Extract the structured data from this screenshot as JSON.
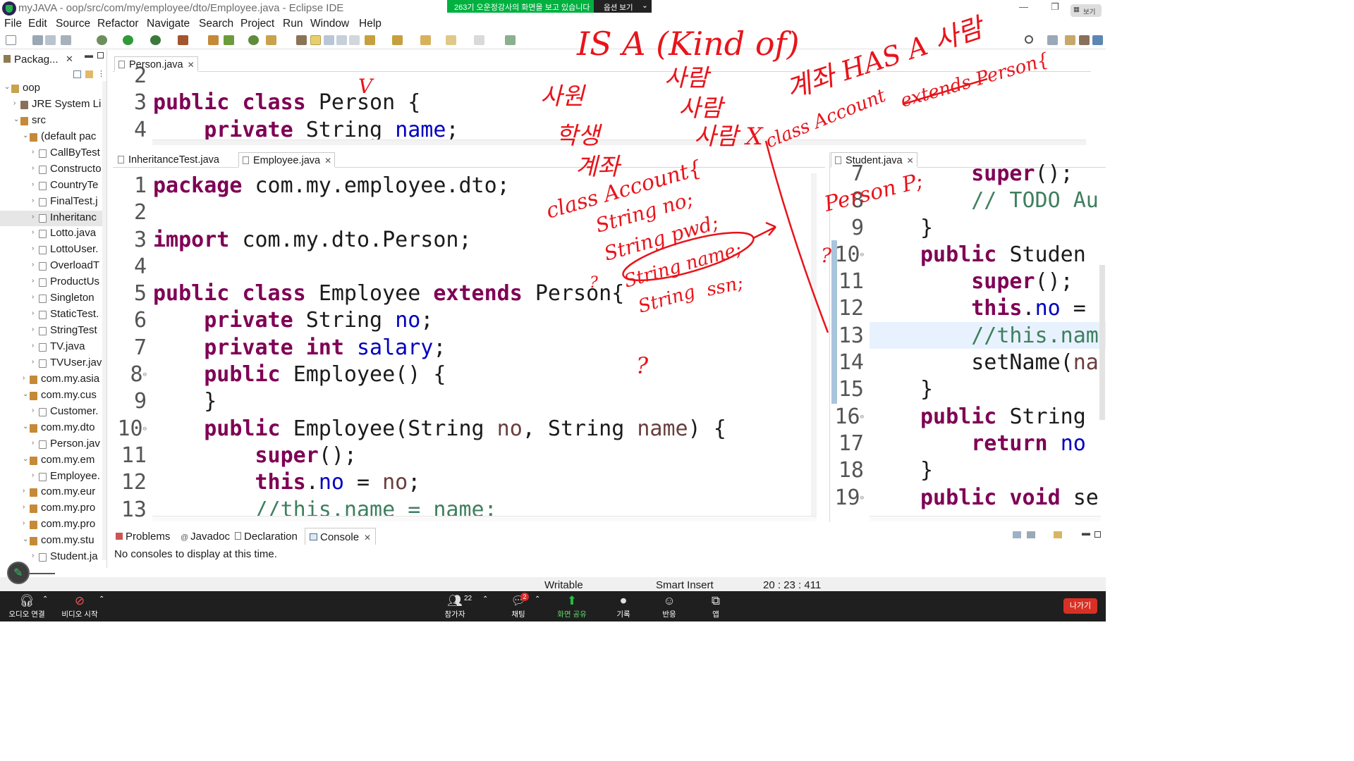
{
  "window": {
    "title": "myJAVA - oop/src/com/my/employee/dto/Employee.java - Eclipse IDE"
  },
  "share_banner": {
    "text": "263기 오운정강사의 화면을 보고 있습니다",
    "options": "옵션 보기",
    "collapse": "보기"
  },
  "menu": [
    "File",
    "Edit",
    "Source",
    "Refactor",
    "Navigate",
    "Search",
    "Project",
    "Run",
    "Window",
    "Help"
  ],
  "package_explorer": {
    "title": "Packag...",
    "items": [
      {
        "label": "oop",
        "indent": 0,
        "expanded": true,
        "icon": "project"
      },
      {
        "label": "JRE System Li",
        "indent": 1,
        "expanded": false,
        "icon": "library"
      },
      {
        "label": "src",
        "indent": 1,
        "expanded": true,
        "icon": "folder"
      },
      {
        "label": "(default pac",
        "indent": 2,
        "expanded": true,
        "icon": "package"
      },
      {
        "label": "CallByTest",
        "indent": 3,
        "expanded": false,
        "icon": "java"
      },
      {
        "label": "Constructo",
        "indent": 3,
        "expanded": false,
        "icon": "java"
      },
      {
        "label": "CountryTe",
        "indent": 3,
        "expanded": false,
        "icon": "java"
      },
      {
        "label": "FinalTest.j",
        "indent": 3,
        "expanded": false,
        "icon": "java"
      },
      {
        "label": "Inheritanc",
        "indent": 3,
        "expanded": false,
        "icon": "java",
        "selected": true
      },
      {
        "label": "Lotto.java",
        "indent": 3,
        "expanded": false,
        "icon": "java"
      },
      {
        "label": "LottoUser.",
        "indent": 3,
        "expanded": false,
        "icon": "java"
      },
      {
        "label": "OverloadT",
        "indent": 3,
        "expanded": false,
        "icon": "java"
      },
      {
        "label": "ProductUs",
        "indent": 3,
        "expanded": false,
        "icon": "java"
      },
      {
        "label": "Singleton",
        "indent": 3,
        "expanded": false,
        "icon": "java"
      },
      {
        "label": "StaticTest.",
        "indent": 3,
        "expanded": false,
        "icon": "java"
      },
      {
        "label": "StringTest",
        "indent": 3,
        "expanded": false,
        "icon": "java"
      },
      {
        "label": "TV.java",
        "indent": 3,
        "expanded": false,
        "icon": "java"
      },
      {
        "label": "TVUser.jav",
        "indent": 3,
        "expanded": false,
        "icon": "java"
      },
      {
        "label": "com.my.asia",
        "indent": 2,
        "expanded": false,
        "icon": "package"
      },
      {
        "label": "com.my.cus",
        "indent": 2,
        "expanded": true,
        "icon": "package"
      },
      {
        "label": "Customer.",
        "indent": 3,
        "expanded": false,
        "icon": "java"
      },
      {
        "label": "com.my.dto",
        "indent": 2,
        "expanded": true,
        "icon": "package"
      },
      {
        "label": "Person.jav",
        "indent": 3,
        "expanded": false,
        "icon": "java"
      },
      {
        "label": "com.my.em",
        "indent": 2,
        "expanded": true,
        "icon": "package"
      },
      {
        "label": "Employee.",
        "indent": 3,
        "expanded": false,
        "icon": "java"
      },
      {
        "label": "com.my.eur",
        "indent": 2,
        "expanded": false,
        "icon": "package"
      },
      {
        "label": "com.my.pro",
        "indent": 2,
        "expanded": false,
        "icon": "package"
      },
      {
        "label": "com.my.pro",
        "indent": 2,
        "expanded": false,
        "icon": "package"
      },
      {
        "label": "com.my.stu",
        "indent": 2,
        "expanded": true,
        "icon": "package"
      },
      {
        "label": "Student.ja",
        "indent": 3,
        "expanded": false,
        "icon": "java"
      }
    ]
  },
  "person_editor": {
    "tab": "Person.java",
    "lines": [
      {
        "n": "2",
        "code": []
      },
      {
        "n": "3",
        "code": [
          [
            "kw",
            "public "
          ],
          [
            "kw",
            "class "
          ],
          [
            "t",
            "Person {"
          ]
        ]
      },
      {
        "n": "4",
        "code": [
          [
            "t",
            "    "
          ],
          [
            "kw",
            "private "
          ],
          [
            "t",
            "String "
          ],
          [
            "fld",
            "name"
          ],
          [
            "t",
            ";"
          ]
        ]
      }
    ]
  },
  "middle_tabs": {
    "inheritance": "InheritanceTest.java",
    "employee": "Employee.java"
  },
  "employee_editor": {
    "lines": [
      {
        "n": "1",
        "code": [
          [
            "kw",
            "package "
          ],
          [
            "t",
            "com.my.employee.dto;"
          ]
        ]
      },
      {
        "n": "2",
        "code": []
      },
      {
        "n": "3",
        "code": [
          [
            "kw",
            "import "
          ],
          [
            "t",
            "com.my.dto.Person;"
          ]
        ]
      },
      {
        "n": "4",
        "code": []
      },
      {
        "n": "5",
        "code": [
          [
            "kw",
            "public "
          ],
          [
            "kw",
            "class "
          ],
          [
            "t",
            "Employee "
          ],
          [
            "kw",
            "extends "
          ],
          [
            "t",
            "Person{"
          ]
        ]
      },
      {
        "n": "6",
        "code": [
          [
            "t",
            "    "
          ],
          [
            "kw",
            "private "
          ],
          [
            "t",
            "String "
          ],
          [
            "fld",
            "no"
          ],
          [
            "t",
            ";"
          ]
        ]
      },
      {
        "n": "7",
        "code": [
          [
            "t",
            "    "
          ],
          [
            "kw",
            "private "
          ],
          [
            "kw",
            "int "
          ],
          [
            "fld",
            "salary"
          ],
          [
            "t",
            ";"
          ]
        ]
      },
      {
        "n": "8",
        "fold": true,
        "code": [
          [
            "t",
            "    "
          ],
          [
            "kw",
            "public "
          ],
          [
            "t",
            "Employee() {"
          ]
        ]
      },
      {
        "n": "9",
        "code": [
          [
            "t",
            "    }"
          ]
        ]
      },
      {
        "n": "10",
        "fold": true,
        "code": [
          [
            "t",
            "    "
          ],
          [
            "kw",
            "public "
          ],
          [
            "t",
            "Employee(String "
          ],
          [
            "var",
            "no"
          ],
          [
            "t",
            ", String "
          ],
          [
            "var",
            "name"
          ],
          [
            "t",
            ") {"
          ]
        ]
      },
      {
        "n": "11",
        "code": [
          [
            "t",
            "        "
          ],
          [
            "kw",
            "super"
          ],
          [
            "t",
            "();"
          ]
        ]
      },
      {
        "n": "12",
        "code": [
          [
            "t",
            "        "
          ],
          [
            "kw",
            "this"
          ],
          [
            "t",
            "."
          ],
          [
            "fld",
            "no"
          ],
          [
            "t",
            " = "
          ],
          [
            "var",
            "no"
          ],
          [
            "t",
            ";"
          ]
        ]
      },
      {
        "n": "13",
        "code": [
          [
            "t",
            "        "
          ],
          [
            "cm",
            "//this.name = name;"
          ]
        ]
      }
    ]
  },
  "student_editor": {
    "tab": "Student.java",
    "lines": [
      {
        "n": "7",
        "code": [
          [
            "t",
            "    "
          ],
          [
            "kw",
            "super"
          ],
          [
            "t",
            "();"
          ]
        ]
      },
      {
        "n": "8",
        "code": [
          [
            "t",
            "    "
          ],
          [
            "cm",
            "// TODO Au"
          ]
        ]
      },
      {
        "n": "9",
        "code": [
          [
            "t",
            "}"
          ]
        ]
      },
      {
        "n": "10",
        "fold": true,
        "code": [
          [
            "kw",
            "public "
          ],
          [
            "t",
            "Studen"
          ]
        ]
      },
      {
        "n": "11",
        "code": [
          [
            "t",
            "    "
          ],
          [
            "kw",
            "super"
          ],
          [
            "t",
            "();"
          ]
        ]
      },
      {
        "n": "12",
        "code": [
          [
            "t",
            "    "
          ],
          [
            "kw",
            "this"
          ],
          [
            "t",
            "."
          ],
          [
            "fld",
            "no"
          ],
          [
            "t",
            " ="
          ]
        ]
      },
      {
        "n": "13",
        "code": [
          [
            "t",
            "    "
          ],
          [
            "cm",
            "//this.nam"
          ]
        ]
      },
      {
        "n": "14",
        "code": [
          [
            "t",
            "    setName("
          ],
          [
            "var",
            "na"
          ]
        ]
      },
      {
        "n": "15",
        "code": [
          [
            "t",
            "}"
          ]
        ]
      },
      {
        "n": "16",
        "fold": true,
        "code": [
          [
            "kw",
            "public "
          ],
          [
            "t",
            "String"
          ]
        ]
      },
      {
        "n": "17",
        "code": [
          [
            "t",
            "    "
          ],
          [
            "kw",
            "return "
          ],
          [
            "fld",
            "no"
          ]
        ]
      },
      {
        "n": "18",
        "code": [
          [
            "t",
            "}"
          ]
        ]
      },
      {
        "n": "19",
        "fold": true,
        "code": [
          [
            "kw",
            "public "
          ],
          [
            "kw",
            "void "
          ],
          [
            "t",
            "se"
          ]
        ]
      }
    ]
  },
  "bottom_panel": {
    "tabs": [
      "Problems",
      "Javadoc",
      "Declaration",
      "Console"
    ],
    "active_tab": "Console",
    "message": "No consoles to display at this time."
  },
  "status": {
    "writable": "Writable",
    "insert_mode": "Smart Insert",
    "position": "20 : 23 : 411"
  },
  "zoom": {
    "audio": "오디오 연결",
    "video": "비디오 시작",
    "participants": "참가자",
    "participants_count": "22",
    "chat": "채팅",
    "chat_badge": "2",
    "share": "화면 공유",
    "record": "기록",
    "reactions": "반응",
    "apps": "앱",
    "leave": "나가기"
  },
  "annotations": {
    "isa": "IS A (Kind of)",
    "hasa": "계좌 HAS A 사람",
    "classAccountExt": "class Account",
    "extendsPerson": "extends Person{",
    "saram1": "사람",
    "saram2": "사람",
    "saram3": "사람 X",
    "sawon": "사원",
    "haksaeng": "학생",
    "gyejwa": "계좌",
    "check": "V",
    "classAccount": "class Account{",
    "strNo": "String no;",
    "strPwd": "String pwd;",
    "strName": "String name;",
    "strWord": "String",
    "ssn": "ssn;",
    "personP": "Person P;",
    "q1": "?",
    "q2": "?",
    "q3": "?"
  },
  "colors": {
    "ink": "#e8141b",
    "keyword": "#7f0055",
    "field": "#0000c0",
    "comment": "#3f7f5f",
    "banner": "#00b140",
    "zoom_bar": "#1f1f1f",
    "leave": "#d93025"
  }
}
